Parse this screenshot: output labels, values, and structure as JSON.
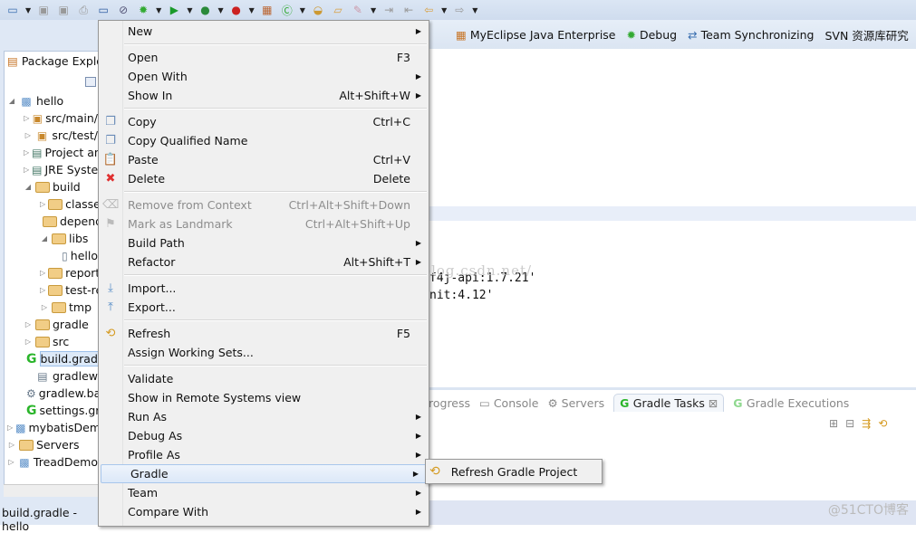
{
  "toolbar": {
    "icons": [
      "new-wizard-icon",
      "save-icon",
      "save-all-icon",
      "print-icon",
      "console-icon",
      "skip-breakpoints-icon",
      "debug-icon",
      "run-icon",
      "coverage-icon",
      "external-tools-icon",
      "new-java-package-icon",
      "new-class-icon",
      "open-type-icon",
      "open-folder-icon",
      "search-icon",
      "next-annotation-icon",
      "prev-annotation-icon",
      "back-icon",
      "forward-icon"
    ]
  },
  "perspectives": [
    {
      "label": "MyEclipse Java Enterprise",
      "icon": "myeclipse-icon"
    },
    {
      "label": "Debug",
      "icon": "bug-icon"
    },
    {
      "label": "Team Synchronizing",
      "icon": "sync-icon"
    },
    {
      "label": "SVN 资源库研究",
      "icon": ""
    }
  ],
  "package_explorer": {
    "title": "Package Explo.",
    "tree": [
      {
        "label": "hello",
        "depth": 0,
        "open": true,
        "icon": "gradle-project-icon"
      },
      {
        "label": "src/main/",
        "depth": 1,
        "icon": "package-icon"
      },
      {
        "label": "src/test/",
        "depth": 1,
        "icon": "package-icon"
      },
      {
        "label": "Project and",
        "depth": 1,
        "icon": "library-icon"
      },
      {
        "label": "JRE System",
        "depth": 1,
        "icon": "library-icon"
      },
      {
        "label": "build",
        "depth": 1,
        "open": true,
        "icon": "folder-icon"
      },
      {
        "label": "classes",
        "depth": 2,
        "icon": "folder-icon"
      },
      {
        "label": "dependency",
        "depth": 2,
        "leaf": true,
        "icon": "folder-icon"
      },
      {
        "label": "libs",
        "depth": 2,
        "open": true,
        "icon": "folder-icon"
      },
      {
        "label": "hello",
        "depth": 3,
        "leaf": true,
        "icon": "jar-icon"
      },
      {
        "label": "reports",
        "depth": 2,
        "icon": "folder-icon"
      },
      {
        "label": "test-results",
        "depth": 2,
        "icon": "folder-icon"
      },
      {
        "label": "tmp",
        "depth": 2,
        "icon": "folder-icon"
      },
      {
        "label": "gradle",
        "depth": 1,
        "icon": "folder-icon"
      },
      {
        "label": "src",
        "depth": 1,
        "icon": "folder-icon"
      },
      {
        "label": "build.gradle",
        "depth": 1,
        "leaf": true,
        "icon": "gradle-file-icon",
        "selected": true
      },
      {
        "label": "gradlew",
        "depth": 1,
        "leaf": true,
        "icon": "text-file-icon"
      },
      {
        "label": "gradlew.bat",
        "depth": 1,
        "leaf": true,
        "icon": "bat-file-icon"
      },
      {
        "label": "settings.gradle",
        "depth": 1,
        "leaf": true,
        "icon": "gradle-file-icon"
      },
      {
        "label": "mybatisDemo",
        "depth": 0,
        "icon": "project-icon"
      },
      {
        "label": "Servers",
        "depth": 0,
        "icon": "folder-icon"
      },
      {
        "label": "TreadDemo",
        "depth": 0,
        "icon": "project-icon"
      }
    ]
  },
  "status": "build.gradle - hello",
  "editor": {
    "lines": [
      "f4j-api:1.7.21'",
      "nit:4.12'"
    ],
    "watermark": "http://blog.csdn.net/"
  },
  "bottom_tabs": [
    {
      "label": "rogress"
    },
    {
      "label": "Console"
    },
    {
      "label": "Servers"
    },
    {
      "label": "Gradle Tasks",
      "active": true
    },
    {
      "label": "Gradle Executions"
    }
  ],
  "menu": [
    {
      "label": "New",
      "sub": true
    },
    "-",
    {
      "label": "Open",
      "shortcut": "F3"
    },
    {
      "label": "Open With",
      "sub": true
    },
    {
      "label": "Show In",
      "shortcut": "Alt+Shift+W",
      "sub": true
    },
    "-",
    {
      "label": "Copy",
      "shortcut": "Ctrl+C",
      "icon": "copy-icon"
    },
    {
      "label": "Copy Qualified Name",
      "icon": "copy-qualified-icon"
    },
    {
      "label": "Paste",
      "shortcut": "Ctrl+V",
      "icon": "paste-icon"
    },
    {
      "label": "Delete",
      "shortcut": "Delete",
      "icon": "delete-icon"
    },
    "-",
    {
      "label": "Remove from Context",
      "shortcut": "Ctrl+Alt+Shift+Down",
      "disabled": true,
      "icon": "remove-context-icon"
    },
    {
      "label": "Mark as Landmark",
      "shortcut": "Ctrl+Alt+Shift+Up",
      "disabled": true,
      "icon": "landmark-icon"
    },
    {
      "label": "Build Path",
      "sub": true
    },
    {
      "label": "Refactor",
      "shortcut": "Alt+Shift+T",
      "sub": true
    },
    "-",
    {
      "label": "Import...",
      "icon": "import-icon"
    },
    {
      "label": "Export...",
      "icon": "export-icon"
    },
    "-",
    {
      "label": "Refresh",
      "shortcut": "F5",
      "icon": "refresh-icon"
    },
    {
      "label": "Assign Working Sets..."
    },
    "-",
    {
      "label": "Validate"
    },
    {
      "label": "Show in Remote Systems view"
    },
    {
      "label": "Run As",
      "sub": true
    },
    {
      "label": "Debug As",
      "sub": true
    },
    {
      "label": "Profile As",
      "sub": true
    },
    {
      "label": "Gradle",
      "sub": true,
      "highlighted": true
    },
    {
      "label": "Team",
      "sub": true
    },
    {
      "label": "Compare With",
      "sub": true
    }
  ],
  "submenu": {
    "label": "Refresh Gradle Project",
    "icon": "refresh-icon"
  },
  "watermark": "@51CTO博客"
}
